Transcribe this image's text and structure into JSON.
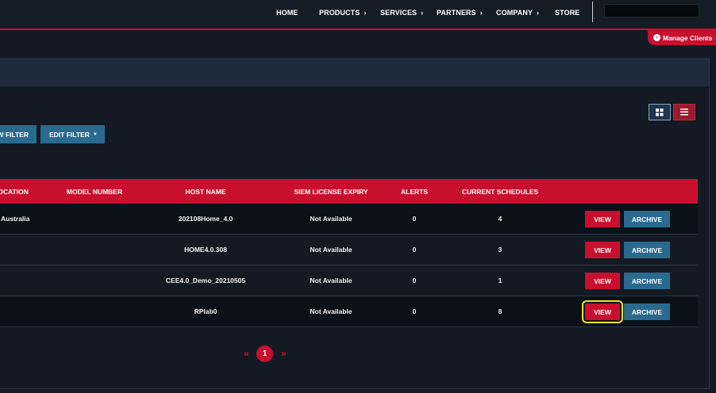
{
  "nav": {
    "items": [
      {
        "label": "HOME",
        "has_submenu": false
      },
      {
        "label": "PRODUCTS",
        "has_submenu": true
      },
      {
        "label": "SERVICES",
        "has_submenu": true
      },
      {
        "label": "PARTNERS",
        "has_submenu": true
      },
      {
        "label": "COMPANY",
        "has_submenu": true
      },
      {
        "label": "STORE",
        "has_submenu": false
      }
    ],
    "submenu_icon": "chevron-right-icon",
    "search_value": ""
  },
  "manage_clients": {
    "label": "Manage Clients",
    "icon": "chevron-left-circle-icon"
  },
  "view_toggle": {
    "grid_icon": "grid-view-icon",
    "list_icon": "list-view-icon",
    "active": "list"
  },
  "filters": {
    "new_filter_label": "NEW FILTER",
    "edit_filter_label": "EDIT FILTER",
    "edit_filter_icon": "caret-down-icon"
  },
  "table": {
    "columns": [
      "LOCATION",
      "MODEL NUMBER",
      "HOST NAME",
      "SIEM LICENSE EXPIRY",
      "ALERTS",
      "CURRENT SCHEDULES",
      ""
    ],
    "view_label": "VIEW",
    "archive_label": "ARCHIVE",
    "rows": [
      {
        "location": "Australia",
        "model_number": "",
        "host_name": "202108Home_4.0",
        "siem_license_expiry": "Not Available",
        "alerts": "0",
        "current_schedules": "4"
      },
      {
        "location": "",
        "model_number": "",
        "host_name": "HOME4.0.308",
        "siem_license_expiry": "Not Available",
        "alerts": "0",
        "current_schedules": "3"
      },
      {
        "location": "",
        "model_number": "",
        "host_name": "CEE4.0_Demo_20210505",
        "siem_license_expiry": "Not Available",
        "alerts": "0",
        "current_schedules": "1"
      },
      {
        "location": "",
        "model_number": "",
        "host_name": "RPlab0",
        "siem_license_expiry": "Not Available",
        "alerts": "0",
        "current_schedules": "8"
      }
    ]
  },
  "pagination": {
    "prev": "«",
    "current": "1",
    "next": "»"
  },
  "colors": {
    "accent_red": "#c8102e",
    "button_blue": "#2b6a8f",
    "background": "#131a23",
    "highlight": "#f2e22c"
  }
}
